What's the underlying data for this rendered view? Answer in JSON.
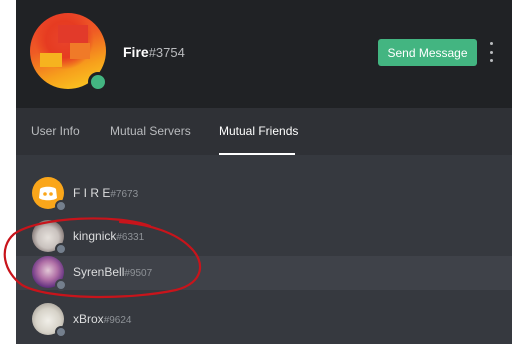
{
  "profile": {
    "username": "Fire",
    "discriminator": "#3754",
    "status_color": "#43b581",
    "send_button_label": "Send Message",
    "more_icon": "more-vertical-icon"
  },
  "tabs": [
    {
      "label": "User Info",
      "active": false
    },
    {
      "label": "Mutual Servers",
      "active": false
    },
    {
      "label": "Mutual Friends",
      "active": true
    }
  ],
  "friends": [
    {
      "name": "F I R E",
      "tag": "#7673",
      "avatar": "discord-default-avatar",
      "avatar_color": "#faa61a",
      "status": "offline"
    },
    {
      "name": "kingnick",
      "tag": "#6331",
      "avatar": "user-avatar",
      "status": "offline"
    },
    {
      "name": "SyrenBell",
      "tag": "#9507",
      "avatar": "user-avatar",
      "status": "offline",
      "hovered": true
    },
    {
      "name": "xBrox",
      "tag": "#9624",
      "avatar": "user-avatar",
      "status": "offline"
    }
  ],
  "colors": {
    "header_bg": "#202225",
    "tabs_bg": "#2f3136",
    "list_bg": "#36393f",
    "accent_green": "#43b581",
    "annotation_red": "#c8141b"
  }
}
